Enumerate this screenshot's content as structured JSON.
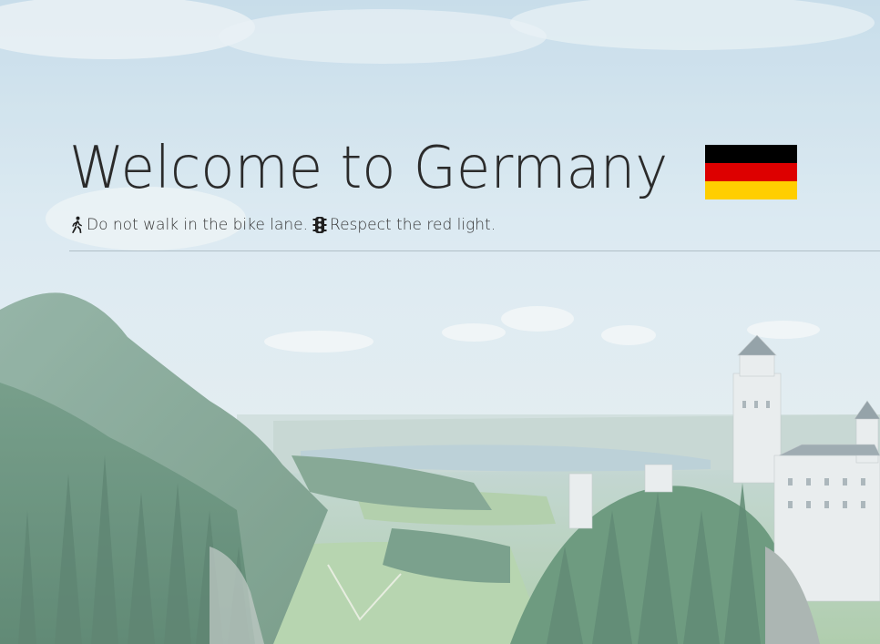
{
  "hero": {
    "title": "Welcome to Germany",
    "flag_colors": [
      "#000000",
      "#DD0000",
      "#FFCE00"
    ],
    "tips": [
      {
        "icon": "pedestrian-icon",
        "text": "Do not walk in the bike lane."
      },
      {
        "icon": "traffic-light-icon",
        "text": "Respect the red light."
      }
    ]
  },
  "colors": {
    "sky": "#cfe3ee",
    "forest": "#5e8f77",
    "meadow": "#9fc79a",
    "lake": "#a8c3cf",
    "castle": "#e7ecee"
  }
}
